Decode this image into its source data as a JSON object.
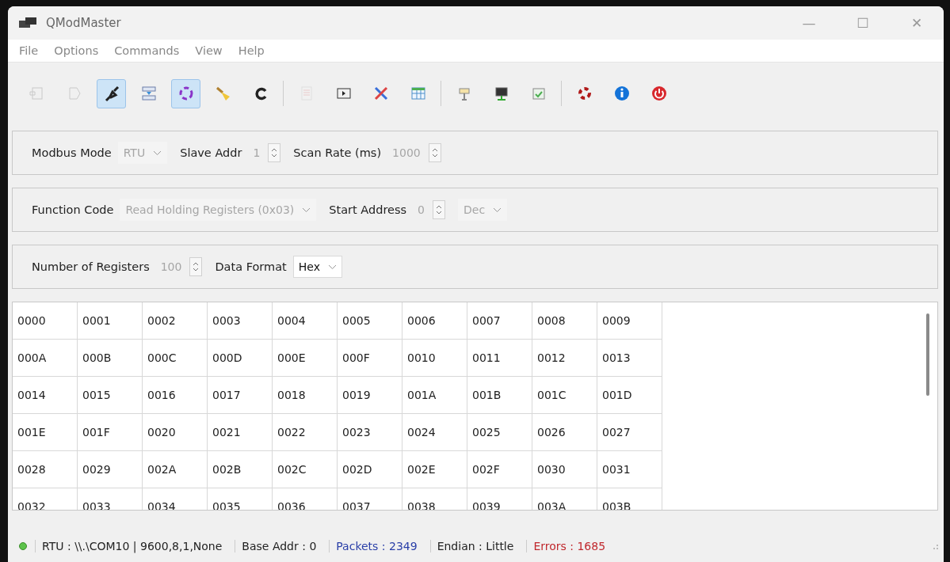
{
  "window": {
    "title": "QModMaster",
    "controls": [
      "—",
      "☐",
      "✕"
    ]
  },
  "menu": [
    "File",
    "Options",
    "Commands",
    "View",
    "Help"
  ],
  "toolbar": [
    {
      "kind": "button",
      "disabled": true
    },
    {
      "kind": "button",
      "disabled": true
    },
    {
      "kind": "toggle",
      "checked": true,
      "disabled": false
    },
    {
      "kind": "button",
      "disabled": false
    },
    {
      "kind": "toggle",
      "checked": true,
      "disabled": false
    },
    {
      "kind": "button",
      "disabled": false
    },
    {
      "kind": "button",
      "disabled": false
    },
    {
      "kind": "separator"
    },
    {
      "kind": "button",
      "disabled": true
    },
    {
      "kind": "button",
      "disabled": false
    },
    {
      "kind": "button",
      "disabled": false
    },
    {
      "kind": "button",
      "disabled": false
    },
    {
      "kind": "separator"
    },
    {
      "kind": "button",
      "disabled": false
    },
    {
      "kind": "button",
      "disabled": false
    },
    {
      "kind": "button",
      "disabled": false
    },
    {
      "kind": "separator"
    },
    {
      "kind": "button",
      "disabled": false
    },
    {
      "kind": "button",
      "disabled": false
    },
    {
      "kind": "button",
      "disabled": false
    }
  ],
  "panels": [
    {
      "fields": [
        {
          "label": "Modbus Mode",
          "kind": "combo",
          "value": "RTU",
          "disabled": true
        },
        {
          "label": "Slave Addr",
          "kind": "spin",
          "value": "1",
          "disabled": true
        },
        {
          "label": "Scan Rate (ms)",
          "kind": "spin",
          "value": "1000",
          "disabled": true
        }
      ]
    },
    {
      "fields": [
        {
          "label": "Function Code",
          "kind": "combo",
          "value": "Read Holding Registers (0x03)",
          "disabled": true
        },
        {
          "label": "Start Address",
          "kind": "spin",
          "value": "0",
          "disabled": true
        },
        {
          "kind": "combo",
          "value": "Dec",
          "disabled": true
        }
      ]
    },
    {
      "fields": [
        {
          "label": "Number of Registers",
          "kind": "spin",
          "value": "100",
          "disabled": true
        },
        {
          "label": "Data Format",
          "kind": "combo",
          "value": "Hex",
          "disabled": false
        }
      ]
    }
  ],
  "table": {
    "rows": [
      [
        "0000",
        "0001",
        "0002",
        "0003",
        "0004",
        "0005",
        "0006",
        "0007",
        "0008",
        "0009"
      ],
      [
        "000A",
        "000B",
        "000C",
        "000D",
        "000E",
        "000F",
        "0010",
        "0011",
        "0012",
        "0013"
      ],
      [
        "0014",
        "0015",
        "0016",
        "0017",
        "0018",
        "0019",
        "001A",
        "001B",
        "001C",
        "001D"
      ],
      [
        "001E",
        "001F",
        "0020",
        "0021",
        "0022",
        "0023",
        "0024",
        "0025",
        "0026",
        "0027"
      ],
      [
        "0028",
        "0029",
        "002A",
        "002B",
        "002C",
        "002D",
        "002E",
        "002F",
        "0030",
        "0031"
      ],
      [
        "0032",
        "0033",
        "0034",
        "0035",
        "0036",
        "0037",
        "0038",
        "0039",
        "003A",
        "003B"
      ]
    ]
  },
  "status_bar": {
    "items": [
      {
        "text": "RTU : \\\\.\\COM10 | 9600,8,1,None",
        "color": "#222222"
      },
      {
        "text": "Base Addr : 0",
        "color": "#222222"
      },
      {
        "text": "Packets : 2349",
        "color": "#2a3fa8"
      },
      {
        "text": "Endian : Little",
        "color": "#222222"
      },
      {
        "text": "Errors : 1685",
        "color": "#c0282d"
      }
    ],
    "connection_on": true
  }
}
